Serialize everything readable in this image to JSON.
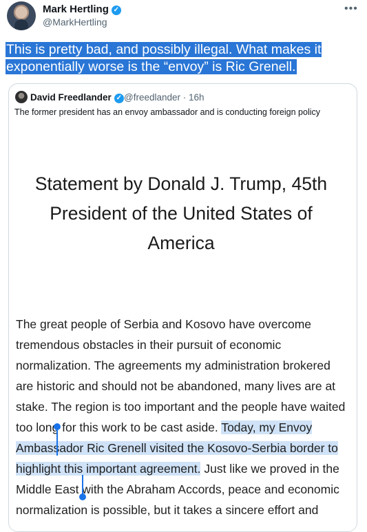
{
  "author": {
    "name": "Mark Hertling",
    "handle": "@MarkHertling",
    "verified_glyph": "✓",
    "more_glyph": "•••"
  },
  "tweet": {
    "text": "This is pretty bad, and possibly illegal. What makes it exponentially worse is the “envoy” is Ric Grenell."
  },
  "quote": {
    "name": "David Freedlander",
    "handle": "@freedlander · 16h",
    "verified_glyph": "✓",
    "text": "The former president has an envoy ambassador and is conducting foreign policy",
    "document": {
      "title": "Statement by Donald J. Trump, 45th President of the United States of America",
      "body_before": "The great people of Serbia and Kosovo have overcome tremendous obstacles in their pursuit of economic normalization. The agreements my administration brokered are historic and should not be abandoned, many lives are at stake. The region is too important and the people have waited too long for this work to be cast aside. ",
      "body_selected": "Today, my Envoy Ambassador Ric Grenell visited the Kosovo-Serbia border to highlight this important agreement.",
      "body_after": " Just like we proved in the Middle East with the Abraham Accords, peace and economic normalization is possible, but it takes a sincere effort and"
    }
  },
  "colors": {
    "selection_tweet": "#2a76d6",
    "selection_doc": "#cfe2f7",
    "handle": "#1a73e8",
    "verified": "#1d9bf0"
  }
}
